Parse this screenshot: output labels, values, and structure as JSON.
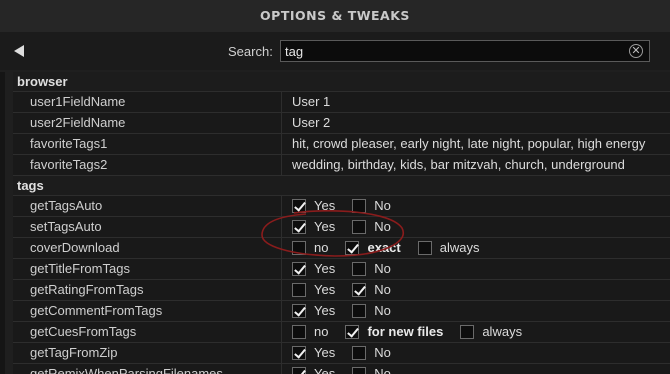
{
  "header": {
    "title": "OPTIONS & TWEAKS"
  },
  "search": {
    "label": "Search:",
    "value": "tag"
  },
  "sections": {
    "browser": {
      "title": "browser",
      "rows": [
        {
          "name": "user1FieldName",
          "value": "User 1"
        },
        {
          "name": "user2FieldName",
          "value": "User 2"
        },
        {
          "name": "favoriteTags1",
          "value": "hit, crowd pleaser, early night, late night, popular, high energy"
        },
        {
          "name": "favoriteTags2",
          "value": "wedding, birthday, kids, bar mitzvah, church, underground"
        }
      ]
    },
    "tags": {
      "title": "tags",
      "rows": [
        {
          "name": "getTagsAuto",
          "options": [
            {
              "label": "Yes",
              "checked": true
            },
            {
              "label": "No",
              "checked": false
            }
          ]
        },
        {
          "name": "setTagsAuto",
          "options": [
            {
              "label": "Yes",
              "checked": true
            },
            {
              "label": "No",
              "checked": false
            }
          ]
        },
        {
          "name": "coverDownload",
          "options": [
            {
              "label": "no",
              "checked": false
            },
            {
              "label": "exact",
              "checked": true
            },
            {
              "label": "always",
              "checked": false
            }
          ]
        },
        {
          "name": "getTitleFromTags",
          "options": [
            {
              "label": "Yes",
              "checked": true
            },
            {
              "label": "No",
              "checked": false
            }
          ]
        },
        {
          "name": "getRatingFromTags",
          "options": [
            {
              "label": "Yes",
              "checked": false
            },
            {
              "label": "No",
              "checked": true
            }
          ]
        },
        {
          "name": "getCommentFromTags",
          "options": [
            {
              "label": "Yes",
              "checked": true
            },
            {
              "label": "No",
              "checked": false
            }
          ]
        },
        {
          "name": "getCuesFromTags",
          "options": [
            {
              "label": "no",
              "checked": false
            },
            {
              "label": "for new files",
              "checked": true
            },
            {
              "label": "always",
              "checked": false
            }
          ]
        },
        {
          "name": "getTagFromZip",
          "options": [
            {
              "label": "Yes",
              "checked": true
            },
            {
              "label": "No",
              "checked": false
            }
          ]
        },
        {
          "name": "getRemixWhenParsingFilenames",
          "options": [
            {
              "label": "Yes",
              "checked": true
            },
            {
              "label": "No",
              "checked": false
            }
          ]
        }
      ]
    }
  },
  "colors": {
    "annotation": "#8a1c1c",
    "background": "#1f1f1f"
  }
}
